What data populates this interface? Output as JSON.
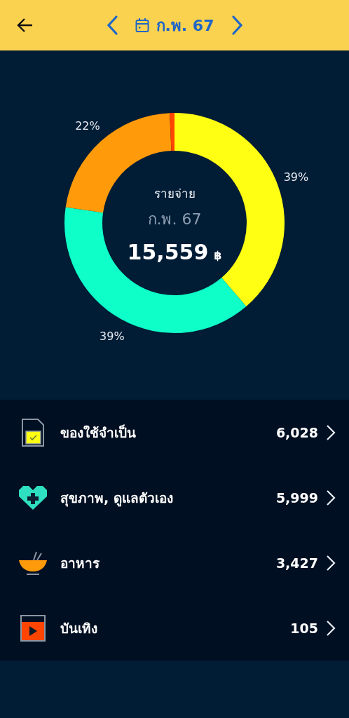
{
  "header": {
    "period": "ก.พ. 67"
  },
  "summary": {
    "label": "รายจ่าย",
    "period": "ก.พ. 67",
    "total": "15,559",
    "currency": "฿",
    "chart_data": {
      "type": "donut",
      "values": [
        38.7,
        38.6,
        22.0,
        0.7
      ],
      "colors": [
        "#ffff14",
        "#0fffc8",
        "#ff9a0a",
        "#ff4500"
      ],
      "value_labels": [
        "39%",
        "39%",
        "22%",
        null
      ]
    }
  },
  "categories": [
    {
      "name": "ของใช้จำเป็น",
      "amount": "6,028",
      "kind": "document"
    },
    {
      "name": "สุขภาพ, ดูแลตัวเอง",
      "amount": "5,999",
      "kind": "health"
    },
    {
      "name": "อาหาร",
      "amount": "3,427",
      "kind": "food"
    },
    {
      "name": "บันเทิง",
      "amount": "105",
      "kind": "video"
    }
  ]
}
